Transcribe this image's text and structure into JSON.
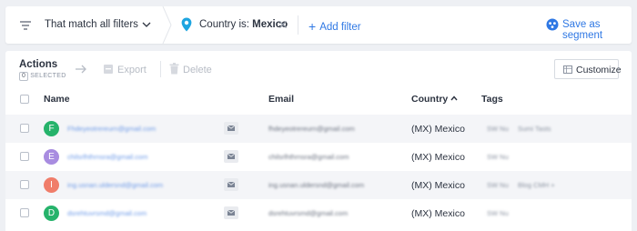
{
  "filter_bar": {
    "match_label": "That match all filters",
    "chip": {
      "prefix": "Country is:",
      "value": "Mexico"
    },
    "add_filter": "Add filter",
    "save_segment": "Save as segment",
    "accent_color": "#2f78e4",
    "pin_color": "#1ea5e0"
  },
  "actions": {
    "title": "Actions",
    "selected_count": "0",
    "selected_label": "SELECTED",
    "export": "Export",
    "delete": "Delete",
    "customize": "Customize"
  },
  "table": {
    "headers": {
      "name": "Name",
      "email": "Email",
      "country": "Country",
      "tags": "Tags"
    },
    "rows": [
      {
        "initial": "F",
        "avatar_color": "#26b36b",
        "name": "Fhdeyeotrereurn@gmail.com",
        "email": "fhdeyeotrereurn@gmail.com",
        "country": "(MX) Mexico",
        "tags": [
          "SW Nu",
          "Sumi Tasts"
        ]
      },
      {
        "initial": "E",
        "avatar_color": "#a88ce0",
        "name": "chilsrlhthrnsra@gmail.com",
        "email": "chilsrlhthrnsra@gmail.com",
        "country": "(MX) Mexico",
        "tags": [
          "SW Nu"
        ]
      },
      {
        "initial": "I",
        "avatar_color": "#f07d6a",
        "name": "ing.usnan.uldersnd@gmail.com",
        "email": "ing.usnan.uldersnd@gmail.com",
        "country": "(MX) Mexico",
        "tags": [
          "SW Nu",
          "Blog CMH +"
        ]
      },
      {
        "initial": "D",
        "avatar_color": "#26b36b",
        "name": "dsrehtuvrsmd@gmail.com",
        "email": "dsrehtuvrsmd@gmail.com",
        "country": "(MX) Mexico",
        "tags": [
          "SW Nu"
        ]
      }
    ]
  }
}
